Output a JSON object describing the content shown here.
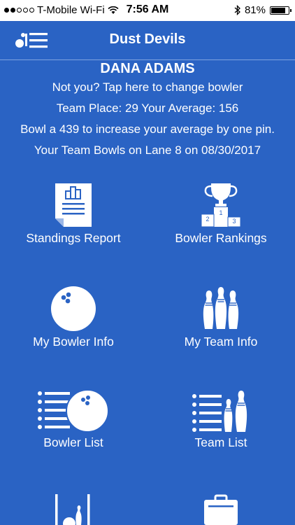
{
  "status": {
    "carrier": "T-Mobile Wi-Fi",
    "time": "7:56 AM",
    "battery": "81%"
  },
  "nav": {
    "title": "Dust Devils"
  },
  "info": {
    "bowler_name": "DANA ADAMS",
    "change_link": "Not you? Tap here to change bowler",
    "team_place": "Team Place: 29 Your Average: 156",
    "increase_msg": "Bowl a 439 to increase your average by one pin.",
    "lane_msg": "Your Team Bowls on Lane 8 on 08/30/2017"
  },
  "menu": [
    {
      "label": "Standings Report"
    },
    {
      "label": "Bowler Rankings"
    },
    {
      "label": "My Bowler Info"
    },
    {
      "label": "My Team Info"
    },
    {
      "label": "Bowler List"
    },
    {
      "label": "Team List"
    }
  ],
  "trophy_places": [
    "1",
    "2",
    "3"
  ],
  "colors": {
    "background": "#2a63c4",
    "foreground": "#ffffff"
  }
}
